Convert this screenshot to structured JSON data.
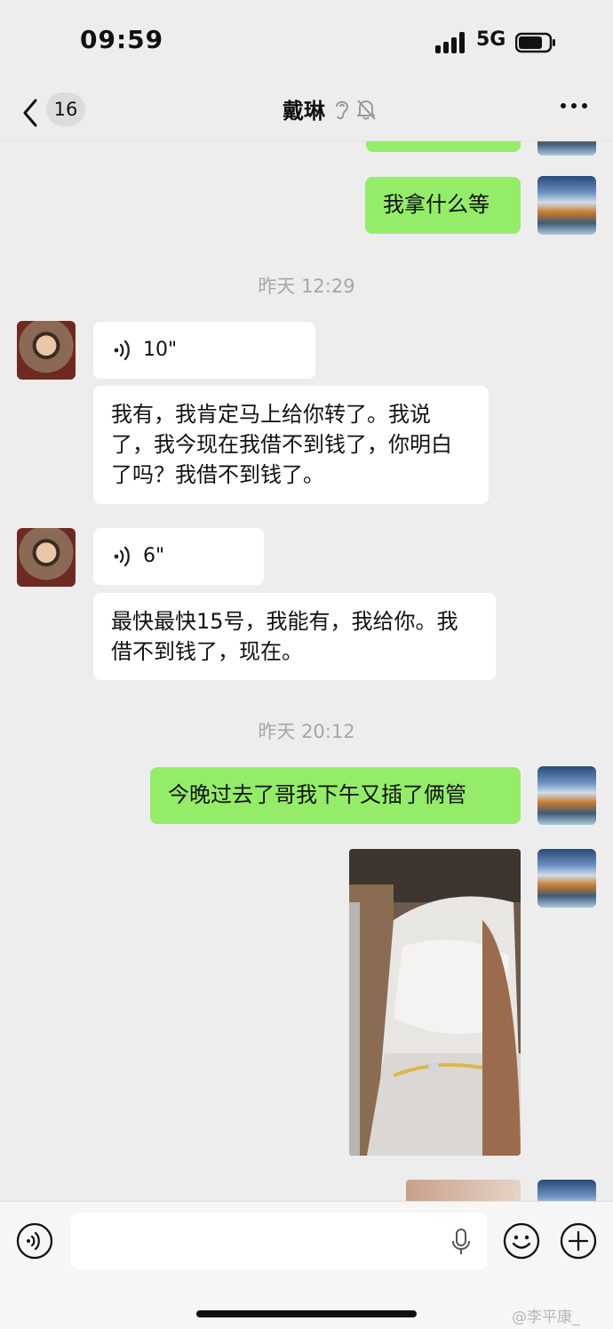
{
  "status": {
    "time": "09:59",
    "network": "5G"
  },
  "nav": {
    "unread_count": "16",
    "title": "戴琳"
  },
  "messages": {
    "m1": "我拿什么等",
    "ts1": "昨天 12:29",
    "v1": "10\"",
    "t1": "我有，我肯定马上给你转了。我说了，我今现在我借不到钱了，你明白了吗？我借不到钱了。",
    "v2": "6\"",
    "t2": "最快最快15号，我能有，我给你。我借不到钱了，现在。",
    "ts2": "昨天 20:12",
    "m2": "今晚过去了哥我下午又插了俩管"
  },
  "watermark": "@李平康_",
  "colors": {
    "sent_bubble": "#95ec69",
    "received_bubble": "#ffffff",
    "background": "#ededed"
  }
}
